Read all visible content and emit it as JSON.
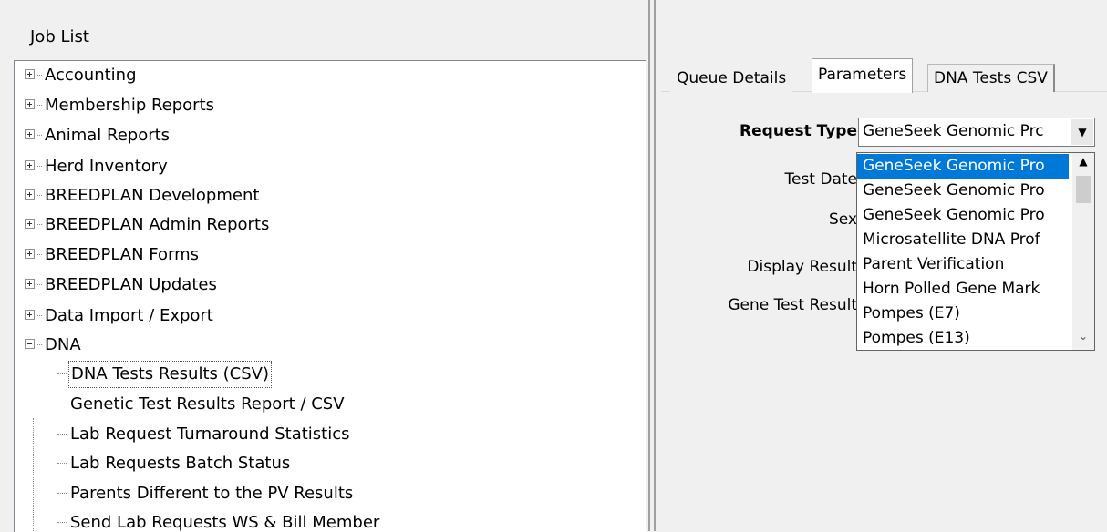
{
  "job_list": {
    "title": "Job List",
    "groups": [
      {
        "label": "Accounting",
        "expanded": false
      },
      {
        "label": "Membership Reports",
        "expanded": false
      },
      {
        "label": "Animal Reports",
        "expanded": false
      },
      {
        "label": "Herd Inventory",
        "expanded": false
      },
      {
        "label": "BREEDPLAN Development",
        "expanded": false
      },
      {
        "label": "BREEDPLAN Admin Reports",
        "expanded": false
      },
      {
        "label": "BREEDPLAN Forms",
        "expanded": false
      },
      {
        "label": "BREEDPLAN Updates",
        "expanded": false
      },
      {
        "label": "Data Import / Export",
        "expanded": false
      },
      {
        "label": "DNA",
        "expanded": true
      }
    ],
    "dna_children": [
      {
        "label": "DNA Tests Results (CSV)",
        "selected": true
      },
      {
        "label": "Genetic Test Results Report / CSV",
        "selected": false
      },
      {
        "label": "Lab Request Turnaround Statistics",
        "selected": false
      },
      {
        "label": "Lab Requests Batch Status",
        "selected": false
      },
      {
        "label": "Parents Different to the PV Results",
        "selected": false
      },
      {
        "label": "Send Lab Requests WS & Bill Member",
        "selected": false
      }
    ]
  },
  "tabs": [
    {
      "label": "Queue Details",
      "active": false
    },
    {
      "label": "Parameters",
      "active": true
    },
    {
      "label": "DNA Tests CSV",
      "active": false
    }
  ],
  "parameters": {
    "request_type_label": "Request Type",
    "test_date_label": "Test Date",
    "sex_label": "Sex",
    "display_result_label": "Display Result",
    "gene_test_result_label": "Gene Test Result",
    "request_type_value": "GeneSeek Genomic Prc",
    "dropdown_options": [
      {
        "label": "GeneSeek Genomic Pro",
        "selected": true
      },
      {
        "label": "GeneSeek Genomic Pro",
        "selected": false
      },
      {
        "label": "GeneSeek Genomic Pro",
        "selected": false
      },
      {
        "label": "Microsatellite DNA Prof",
        "selected": false
      },
      {
        "label": "Parent Verification",
        "selected": false
      },
      {
        "label": "Horn Polled Gene Mark",
        "selected": false
      },
      {
        "label": "Pompes (E7)",
        "selected": false
      },
      {
        "label": "Pompes (E13)",
        "selected": false
      }
    ]
  },
  "colors": {
    "selection": "#0078d7",
    "window_bg": "#f0f0f0",
    "tree_bg": "#ffffff"
  }
}
